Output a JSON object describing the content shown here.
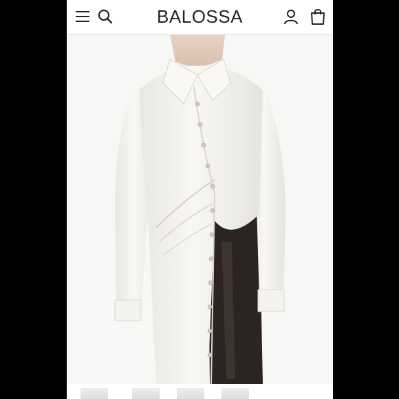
{
  "header": {
    "brand": "BALOSSA",
    "menu_icon": "hamburger-menu-icon",
    "search_icon": "search-icon",
    "account_icon": "user-account-icon",
    "cart_icon": "shopping-bag-icon"
  },
  "product": {
    "image_desc": "white-draped-button-shirt-photo"
  },
  "gallery": {
    "count": 4,
    "selected_index": 0
  },
  "colors": {
    "header_bg": "#ffffff",
    "page_bg": "#000000",
    "icon_color": "#222222"
  }
}
